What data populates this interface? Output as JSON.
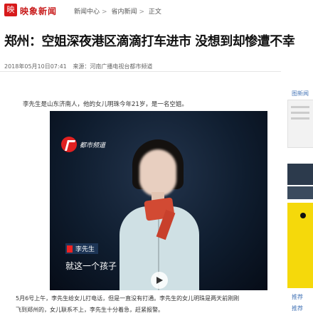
{
  "header": {
    "logo_glyph": "映",
    "brand": "映象新闻",
    "breadcrumb": [
      "新闻中心",
      "省内新闻",
      "正文"
    ],
    "breadcrumb_sep": ">"
  },
  "article": {
    "title": "郑州：空姐深夜港区滴滴打车进市 没想到却惨遭不幸",
    "date": "2018年05月10日07:41",
    "source": "来源：河南广播电视台都市频道",
    "caption_top": "李先生是山东济南人，他的女儿明珠今年21岁，是一名空姐。",
    "caption_bottom_1": "5月6号上午，李先生给女儿打电话，但是一直没有打通。李先生的女儿明珠是两天前刚刚",
    "caption_bottom_2": "飞到郑州的，女儿联系不上，李先生十分着急，赶紧报警。"
  },
  "video": {
    "channel_name": "都市频道",
    "name_tag": "李先生",
    "subtitle": "就这一个孩子"
  },
  "sidebar": {
    "label_top": "图新闻",
    "label_bottom_1": "推荐",
    "label_bottom_2": "推荐"
  }
}
